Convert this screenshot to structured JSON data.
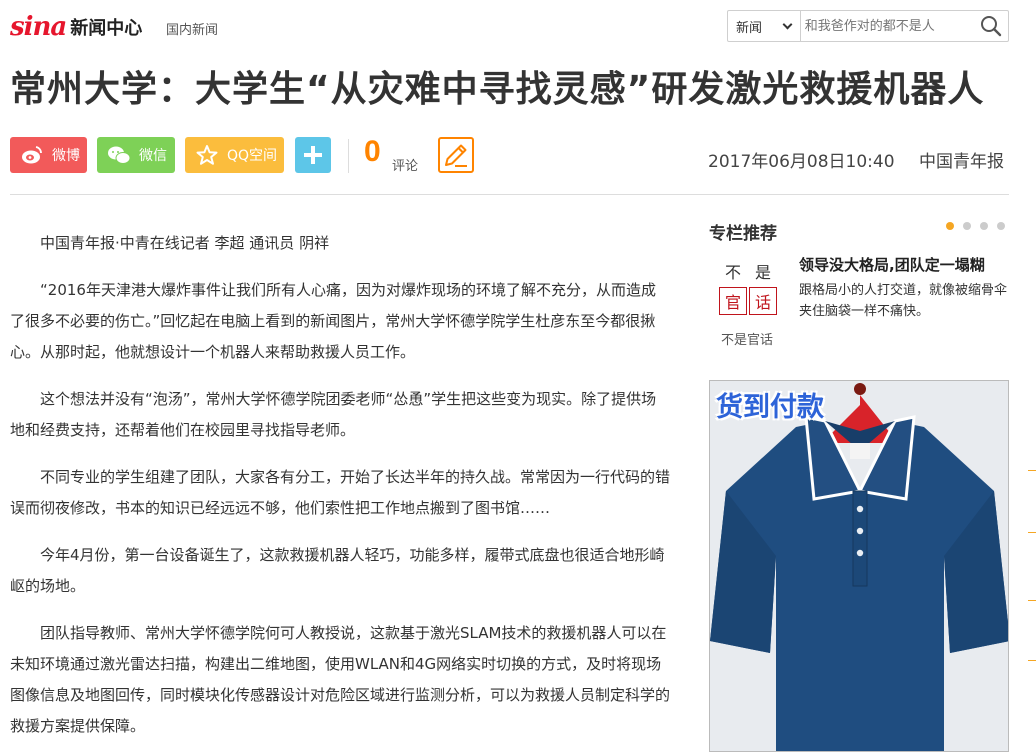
{
  "header": {
    "logo_brand": "sina",
    "logo_text": "新闻中心",
    "channel": "国内新闻",
    "search": {
      "category": "新闻",
      "placeholder": "和我爸作对的都不是人"
    }
  },
  "article": {
    "title": "常州大学：大学生“从灾难中寻找灵感”研发激光救援机器人",
    "share": {
      "weibo": "微博",
      "wechat": "微信",
      "qzone": "QQ空间",
      "comment_count": "0",
      "comment_label": "评论"
    },
    "date": "2017年06月08日10:40",
    "source": "中国青年报",
    "paragraphs": [
      "中国青年报·中青在线记者 李超 通讯员 阴祥",
      "“2016年天津港大爆炸事件让我们所有人心痛，因为对爆炸现场的环境了解不充分，从而造成了很多不必要的伤亡。”回忆起在电脑上看到的新闻图片，常州大学怀德学院学生杜彦东至今都很揪心。从那时起，他就想设计一个机器人来帮助救援人员工作。",
      "这个想法并没有“泡汤”，常州大学怀德学院团委老师“怂恿”学生把这些变为现实。除了提供场地和经费支持，还帮着他们在校园里寻找指导老师。",
      "不同专业的学生组建了团队，大家各有分工，开始了长达半年的持久战。常常因为一行代码的错误而彻夜修改，书本的知识已经远远不够，他们索性把工作地点搬到了图书馆……",
      "今年4月份，第一台设备诞生了，这款救援机器人轻巧，功能多样，履带式底盘也很适合地形崎岖的场地。",
      "团队指导教师、常州大学怀德学院何可人教授说，这款基于激光SLAM技术的救援机器人可以在未知环境通过激光雷达扫描，构建出二维地图，使用WLAN和4G网络实时切换的方式，及时将现场图像信息及地图回传，同时模块化传感器设计对危险区域进行监测分析，可以为救援人员制定科学的救援方案提供保障。"
    ]
  },
  "sidebar": {
    "title": "专栏推荐",
    "carousel_active_index": 0,
    "carousel_count": 4,
    "card": {
      "thumb_chars": [
        "不",
        "是",
        "官",
        "话"
      ],
      "caption": "不是官话",
      "title": "领导没大格局,团队定一塌糊",
      "desc": "跟格局小的人打交道，就像被缩骨伞夹住脑袋一样不痛快。"
    },
    "ad": {
      "label": "货到付款"
    }
  },
  "colors": {
    "weibo": "#f25a5a",
    "wechat": "#7ed157",
    "qzone": "#fbbd3d",
    "more": "#5dc6e8",
    "accent": "#ff8400",
    "brand": "#e6162d"
  }
}
